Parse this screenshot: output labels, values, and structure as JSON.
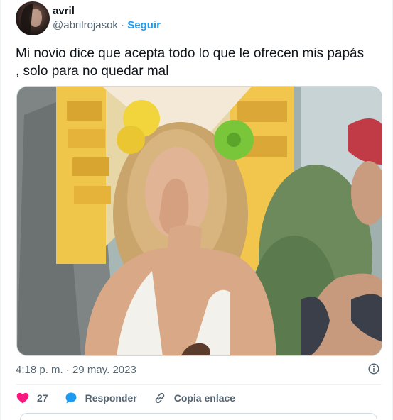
{
  "author": {
    "display_name": "avril",
    "handle": "@abrilrojasok",
    "separator": "·",
    "follow_label": "Seguir"
  },
  "tweet": {
    "text": "Mi novio dice que acepta todo lo que le ofrecen mis papás , solo para no quedar mal",
    "timestamp": "4:18 p. m. · 29 may. 2023"
  },
  "actions": {
    "likes_count": "27",
    "reply_label": "Responder",
    "copy_link_label": "Copia enlace"
  },
  "icons": {
    "like": "heart-icon",
    "reply": "speech-bubble-icon",
    "copy": "link-icon",
    "info": "info-icon"
  },
  "colors": {
    "accent": "#1d9bf0",
    "like": "#f91880",
    "text": "#0f1419",
    "muted": "#536471"
  }
}
